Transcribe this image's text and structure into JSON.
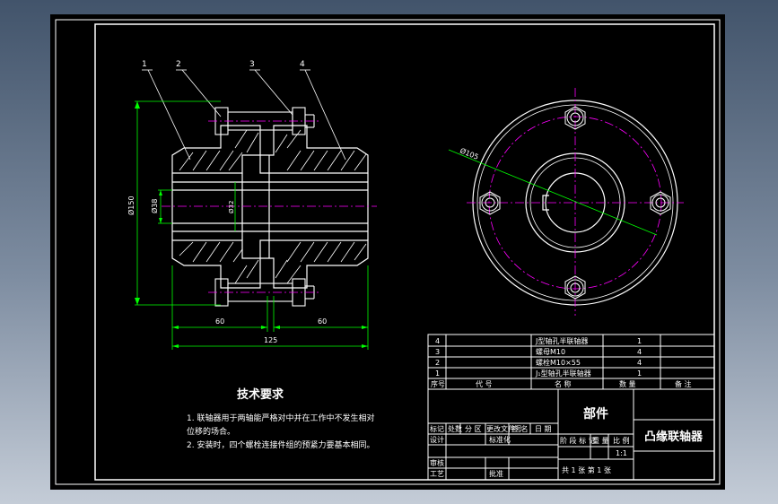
{
  "drawing": {
    "title": "凸缘联轴器",
    "kind": "部件",
    "scale": "1:1",
    "sheet_label": "共 1 张  第 1 张"
  },
  "parts": [
    {
      "no": "4",
      "name": "J型轴孔半联轴器",
      "qty": "1"
    },
    {
      "no": "3",
      "name": "螺母M10",
      "qty": "4"
    },
    {
      "no": "2",
      "name": "螺栓M10×55",
      "qty": "4"
    },
    {
      "no": "1",
      "name": "J₁型轴孔半联轴器",
      "qty": "1"
    }
  ],
  "parts_header": {
    "no": "序号",
    "code": "代 号",
    "name": "名 称",
    "qty": "数 量",
    "remark": "备 注"
  },
  "title_block": {
    "row1": [
      "标记",
      "处数",
      "分 区",
      "更改文件号",
      "签 名",
      "日 期"
    ],
    "design": "设计",
    "standard": "标准化",
    "review": "审核",
    "process": "工艺",
    "approve": "批准",
    "stage_header": "阶 段 标 记",
    "weight": "重 量",
    "ratio": "比 例"
  },
  "requirements": {
    "heading": "技术要求",
    "items": [
      "1. 联轴器用于两轴能严格对中并在工作中不发生相对",
      "位移的场合。",
      "2. 安装时，四个螺栓连接件组的预紧力要基本相同。"
    ]
  },
  "balloons": [
    "1",
    "2",
    "3",
    "4"
  ],
  "dimensions": {
    "outer_dia": "Ø150",
    "bore_dia": "Ø38",
    "bore_dia_2": "Ø32",
    "left_len": "60",
    "right_len": "60",
    "total_len": "125",
    "bolt_circle": "Ø105"
  },
  "colors": {
    "background": "#000000",
    "lines": "#ffffff",
    "dimension": "#00ff00",
    "centerline": "#ff00ff",
    "leader": "#ffffff"
  }
}
